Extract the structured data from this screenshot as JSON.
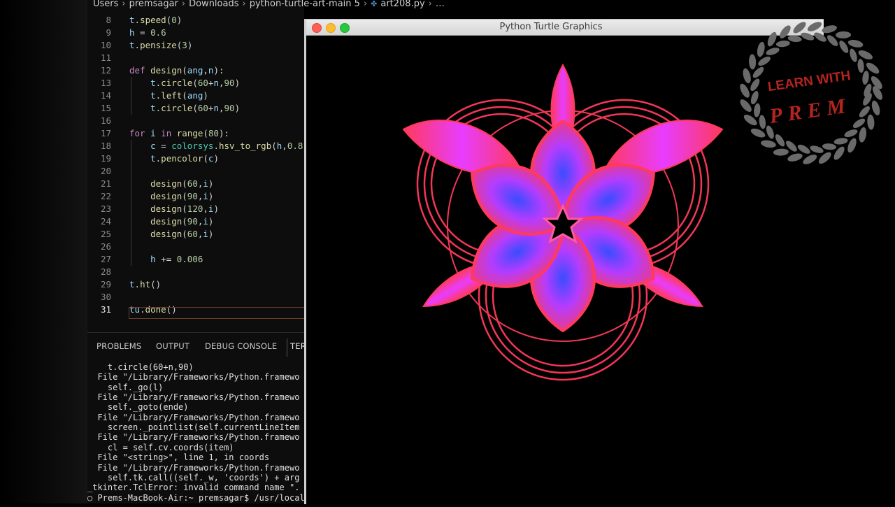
{
  "breadcrumb": {
    "items": [
      "Users",
      "premsagar",
      "Downloads",
      "python-turtle-art-main 5"
    ],
    "file": "art208.py",
    "more": "…",
    "file_icon": "python-file-icon"
  },
  "editor": {
    "lines": [
      {
        "n": "8",
        "text": "t.speed(0)"
      },
      {
        "n": "9",
        "text": "h = 0.6"
      },
      {
        "n": "10",
        "text": "t.pensize(3)"
      },
      {
        "n": "11",
        "text": ""
      },
      {
        "n": "12",
        "text": "def design(ang,n):"
      },
      {
        "n": "13",
        "text": "    t.circle(60+n,90)"
      },
      {
        "n": "14",
        "text": "    t.left(ang)"
      },
      {
        "n": "15",
        "text": "    t.circle(60+n,90)"
      },
      {
        "n": "16",
        "text": ""
      },
      {
        "n": "17",
        "text": "for i in range(80):"
      },
      {
        "n": "18",
        "text": "    c = colorsys.hsv_to_rgb(h,0.8,"
      },
      {
        "n": "19",
        "text": "    t.pencolor(c)"
      },
      {
        "n": "20",
        "text": ""
      },
      {
        "n": "21",
        "text": "    design(60,i)"
      },
      {
        "n": "22",
        "text": "    design(90,i)"
      },
      {
        "n": "23",
        "text": "    design(120,i)"
      },
      {
        "n": "24",
        "text": "    design(90,i)"
      },
      {
        "n": "25",
        "text": "    design(60,i)"
      },
      {
        "n": "26",
        "text": ""
      },
      {
        "n": "27",
        "text": "    h += 0.006"
      },
      {
        "n": "28",
        "text": ""
      },
      {
        "n": "29",
        "text": "t.ht()"
      },
      {
        "n": "30",
        "text": ""
      },
      {
        "n": "31",
        "text": "tu.done()"
      }
    ],
    "active_line": "31"
  },
  "panel": {
    "tabs": [
      "PROBLEMS",
      "OUTPUT",
      "DEBUG CONSOLE",
      "TER"
    ]
  },
  "terminal": {
    "lines": [
      "    t.circle(60+n,90)",
      "  File \"/Library/Frameworks/Python.framewo",
      "    self._go(l)",
      "  File \"/Library/Frameworks/Python.framewo",
      "    self._goto(ende)",
      "  File \"/Library/Frameworks/Python.framewo",
      "    screen._pointlist(self.currentLineItem",
      "  File \"/Library/Frameworks/Python.framewo",
      "    cl = self.cv.coords(item)",
      "  File \"<string>\", line 1, in coords",
      "  File \"/Library/Frameworks/Python.framewo",
      "    self.tk.call((self._w, 'coords') + arg",
      "_tkinter.TclError: invalid command name \".",
      "○ Prems-MacBook-Air:~ premsagar$ /usr/local/"
    ]
  },
  "turtle_window": {
    "title": "Python Turtle Graphics",
    "controls": [
      "close",
      "minimize",
      "zoom"
    ]
  },
  "watermark": {
    "line1": "LEARN WITH",
    "line2": "PREM",
    "text_color": "#b3241f",
    "wreath_color": "#6a6a6a"
  },
  "colors": {
    "editor_bg": "#0d0d0d",
    "art_outer": "#ff3a5c",
    "art_mid": "#e83cff",
    "art_inner": "#3a4cff"
  }
}
